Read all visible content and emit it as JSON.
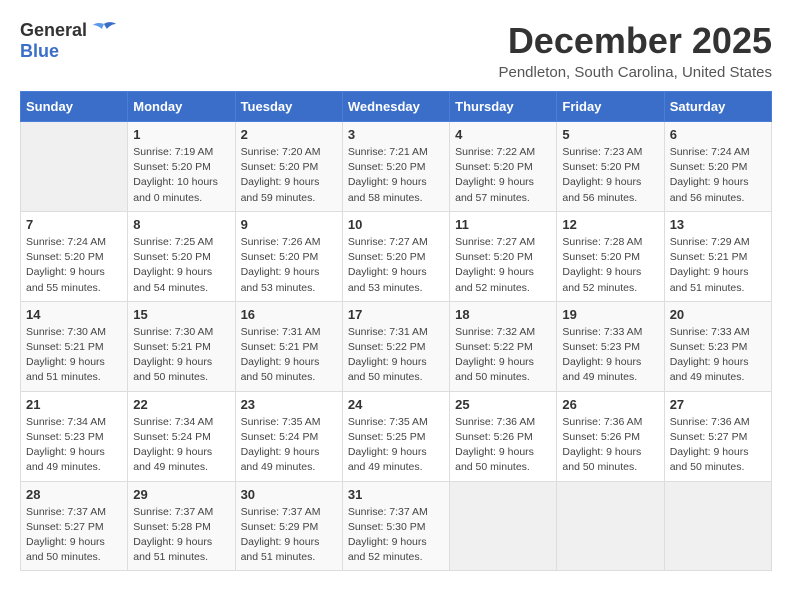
{
  "logo": {
    "general": "General",
    "blue": "Blue"
  },
  "title": "December 2025",
  "location": "Pendleton, South Carolina, United States",
  "days_of_week": [
    "Sunday",
    "Monday",
    "Tuesday",
    "Wednesday",
    "Thursday",
    "Friday",
    "Saturday"
  ],
  "weeks": [
    [
      {
        "day": "",
        "info": ""
      },
      {
        "day": "1",
        "info": "Sunrise: 7:19 AM\nSunset: 5:20 PM\nDaylight: 10 hours\nand 0 minutes."
      },
      {
        "day": "2",
        "info": "Sunrise: 7:20 AM\nSunset: 5:20 PM\nDaylight: 9 hours\nand 59 minutes."
      },
      {
        "day": "3",
        "info": "Sunrise: 7:21 AM\nSunset: 5:20 PM\nDaylight: 9 hours\nand 58 minutes."
      },
      {
        "day": "4",
        "info": "Sunrise: 7:22 AM\nSunset: 5:20 PM\nDaylight: 9 hours\nand 57 minutes."
      },
      {
        "day": "5",
        "info": "Sunrise: 7:23 AM\nSunset: 5:20 PM\nDaylight: 9 hours\nand 56 minutes."
      },
      {
        "day": "6",
        "info": "Sunrise: 7:24 AM\nSunset: 5:20 PM\nDaylight: 9 hours\nand 56 minutes."
      }
    ],
    [
      {
        "day": "7",
        "info": "Sunrise: 7:24 AM\nSunset: 5:20 PM\nDaylight: 9 hours\nand 55 minutes."
      },
      {
        "day": "8",
        "info": "Sunrise: 7:25 AM\nSunset: 5:20 PM\nDaylight: 9 hours\nand 54 minutes."
      },
      {
        "day": "9",
        "info": "Sunrise: 7:26 AM\nSunset: 5:20 PM\nDaylight: 9 hours\nand 53 minutes."
      },
      {
        "day": "10",
        "info": "Sunrise: 7:27 AM\nSunset: 5:20 PM\nDaylight: 9 hours\nand 53 minutes."
      },
      {
        "day": "11",
        "info": "Sunrise: 7:27 AM\nSunset: 5:20 PM\nDaylight: 9 hours\nand 52 minutes."
      },
      {
        "day": "12",
        "info": "Sunrise: 7:28 AM\nSunset: 5:20 PM\nDaylight: 9 hours\nand 52 minutes."
      },
      {
        "day": "13",
        "info": "Sunrise: 7:29 AM\nSunset: 5:21 PM\nDaylight: 9 hours\nand 51 minutes."
      }
    ],
    [
      {
        "day": "14",
        "info": "Sunrise: 7:30 AM\nSunset: 5:21 PM\nDaylight: 9 hours\nand 51 minutes."
      },
      {
        "day": "15",
        "info": "Sunrise: 7:30 AM\nSunset: 5:21 PM\nDaylight: 9 hours\nand 50 minutes."
      },
      {
        "day": "16",
        "info": "Sunrise: 7:31 AM\nSunset: 5:21 PM\nDaylight: 9 hours\nand 50 minutes."
      },
      {
        "day": "17",
        "info": "Sunrise: 7:31 AM\nSunset: 5:22 PM\nDaylight: 9 hours\nand 50 minutes."
      },
      {
        "day": "18",
        "info": "Sunrise: 7:32 AM\nSunset: 5:22 PM\nDaylight: 9 hours\nand 50 minutes."
      },
      {
        "day": "19",
        "info": "Sunrise: 7:33 AM\nSunset: 5:23 PM\nDaylight: 9 hours\nand 49 minutes."
      },
      {
        "day": "20",
        "info": "Sunrise: 7:33 AM\nSunset: 5:23 PM\nDaylight: 9 hours\nand 49 minutes."
      }
    ],
    [
      {
        "day": "21",
        "info": "Sunrise: 7:34 AM\nSunset: 5:23 PM\nDaylight: 9 hours\nand 49 minutes."
      },
      {
        "day": "22",
        "info": "Sunrise: 7:34 AM\nSunset: 5:24 PM\nDaylight: 9 hours\nand 49 minutes."
      },
      {
        "day": "23",
        "info": "Sunrise: 7:35 AM\nSunset: 5:24 PM\nDaylight: 9 hours\nand 49 minutes."
      },
      {
        "day": "24",
        "info": "Sunrise: 7:35 AM\nSunset: 5:25 PM\nDaylight: 9 hours\nand 49 minutes."
      },
      {
        "day": "25",
        "info": "Sunrise: 7:36 AM\nSunset: 5:26 PM\nDaylight: 9 hours\nand 50 minutes."
      },
      {
        "day": "26",
        "info": "Sunrise: 7:36 AM\nSunset: 5:26 PM\nDaylight: 9 hours\nand 50 minutes."
      },
      {
        "day": "27",
        "info": "Sunrise: 7:36 AM\nSunset: 5:27 PM\nDaylight: 9 hours\nand 50 minutes."
      }
    ],
    [
      {
        "day": "28",
        "info": "Sunrise: 7:37 AM\nSunset: 5:27 PM\nDaylight: 9 hours\nand 50 minutes."
      },
      {
        "day": "29",
        "info": "Sunrise: 7:37 AM\nSunset: 5:28 PM\nDaylight: 9 hours\nand 51 minutes."
      },
      {
        "day": "30",
        "info": "Sunrise: 7:37 AM\nSunset: 5:29 PM\nDaylight: 9 hours\nand 51 minutes."
      },
      {
        "day": "31",
        "info": "Sunrise: 7:37 AM\nSunset: 5:30 PM\nDaylight: 9 hours\nand 52 minutes."
      },
      {
        "day": "",
        "info": ""
      },
      {
        "day": "",
        "info": ""
      },
      {
        "day": "",
        "info": ""
      }
    ]
  ]
}
